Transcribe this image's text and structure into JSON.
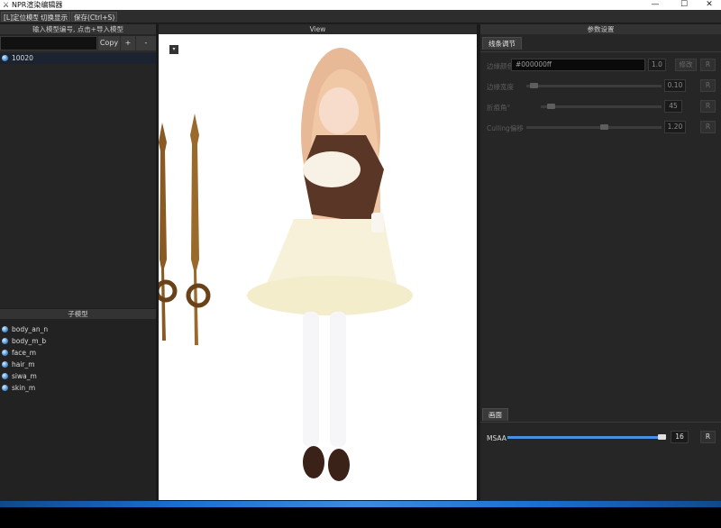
{
  "window": {
    "title": "NPR渲染编辑器",
    "minimize": "—",
    "maximize": "☐",
    "close": "✕"
  },
  "menu": {
    "locate": "[L]定位模型",
    "toggle": "切换显示",
    "save": "保存(Ctrl+S)"
  },
  "left": {
    "header": "输入模型编号, 点击+导入模型",
    "input_value": "",
    "copy": "Copy",
    "add": "+",
    "remove": "-",
    "models": [
      {
        "name": "10020"
      }
    ],
    "sub_header": "子模型",
    "submodels": [
      {
        "name": "body_an_n"
      },
      {
        "name": "body_m_b"
      },
      {
        "name": "face_m"
      },
      {
        "name": "hair_m"
      },
      {
        "name": "siwa_m"
      },
      {
        "name": "skin_m"
      }
    ]
  },
  "view": {
    "header": "View",
    "menu_button": "▾"
  },
  "params": {
    "header": "参数设置",
    "tab": "线条调节",
    "rows": [
      {
        "label": "边缘颜色",
        "color": "#000000ff",
        "value": "1.0",
        "action": "修改",
        "reset": "R"
      },
      {
        "label": "边缘宽度",
        "value": "0.10",
        "level": 0.03,
        "reset": "R"
      },
      {
        "label": "折痕角°",
        "value": "45",
        "level": 0.05,
        "reset": "R"
      },
      {
        "label": "Culling偏移",
        "value": "1.20",
        "level": 0.6,
        "reset": "R"
      }
    ],
    "bottom_tab": "画面",
    "msaa": {
      "label": "MSAA",
      "value": "16",
      "level": 1.0,
      "reset": "R"
    }
  },
  "colors": {
    "accent": "#4a90e2",
    "taskbar": "#1a6fd0"
  }
}
